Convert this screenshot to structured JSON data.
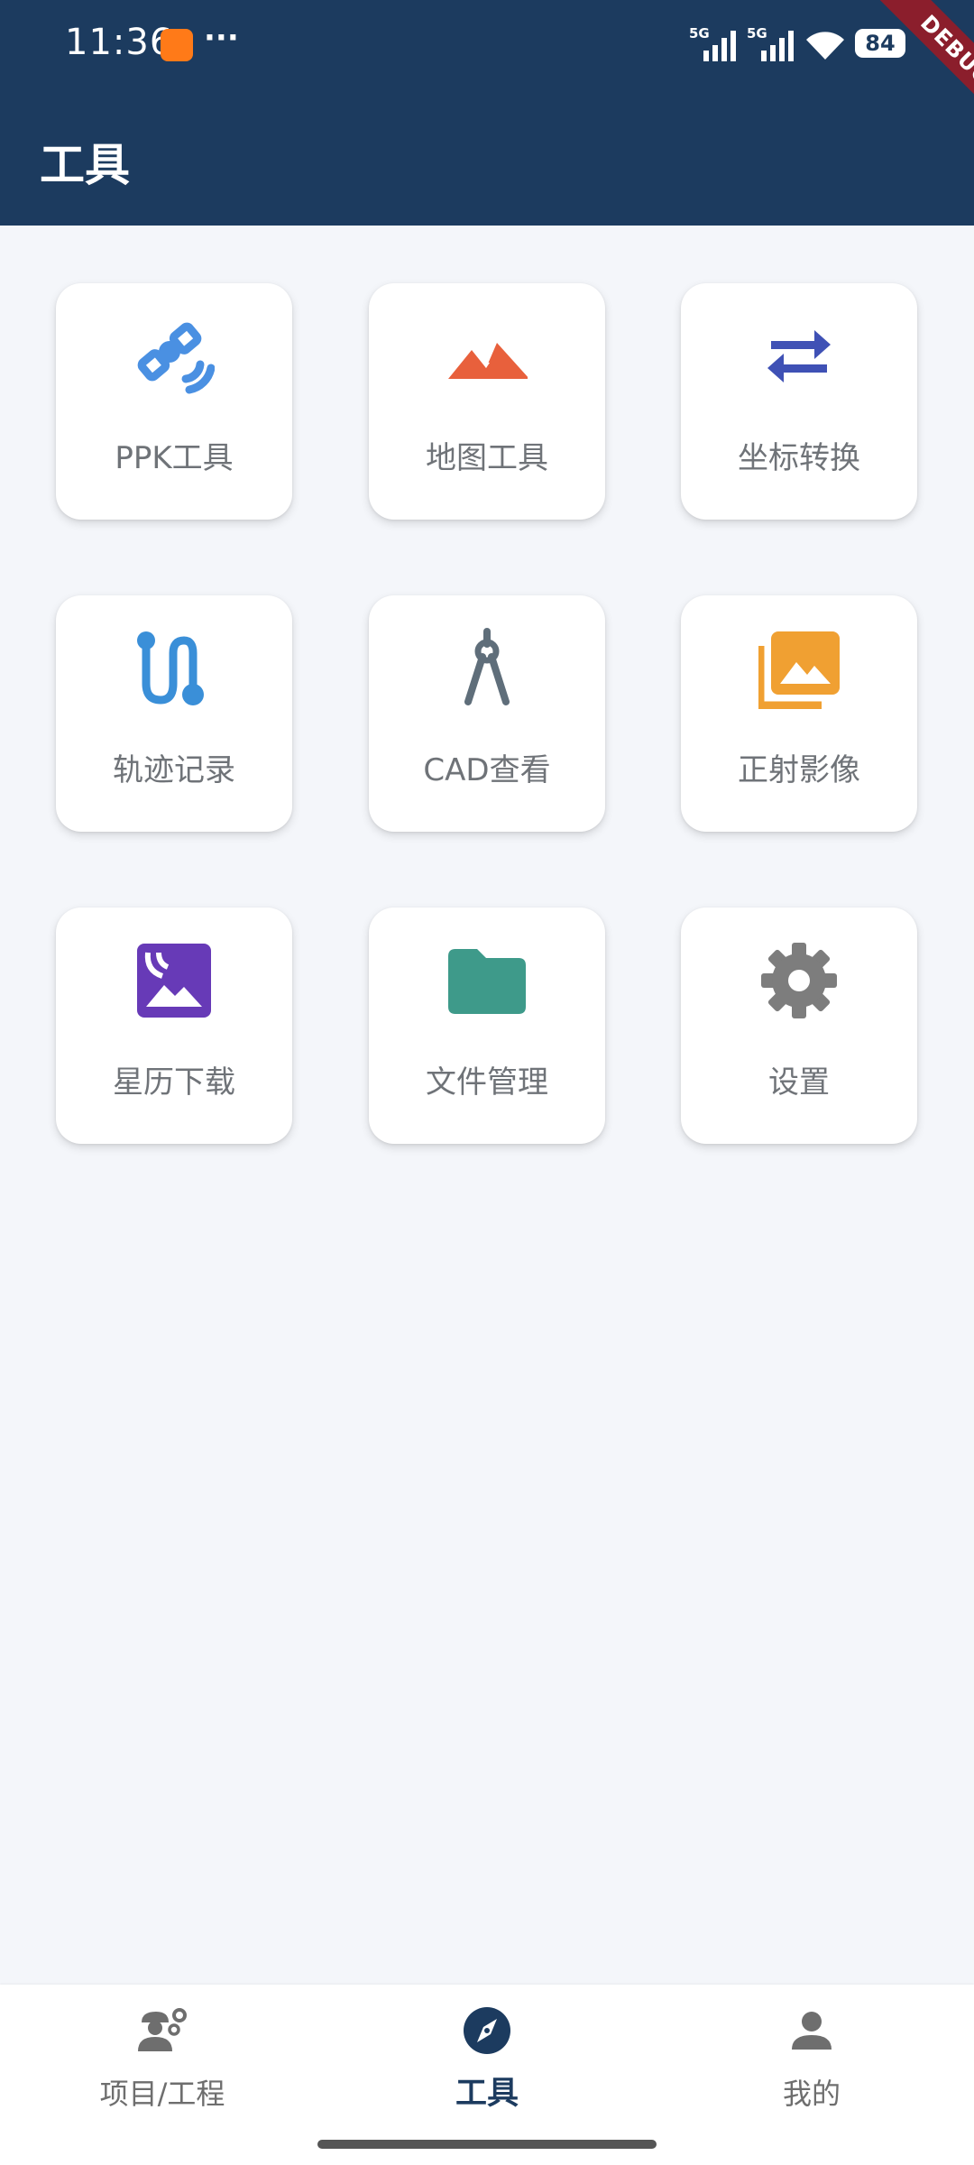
{
  "status_bar": {
    "time": "11:36",
    "more": "···",
    "signal_1_label": "5G",
    "signal_2_label": "5G",
    "battery": "84",
    "debug_banner": "DEBUG"
  },
  "header": {
    "title": "工具"
  },
  "tools": [
    {
      "label": "PPK工具",
      "icon": "satellite-icon",
      "color": "#4a90e2"
    },
    {
      "label": "地图工具",
      "icon": "mountain-icon",
      "color": "#e8603c"
    },
    {
      "label": "坐标转换",
      "icon": "swap-arrows-icon",
      "color": "#3f51b5"
    },
    {
      "label": "轨迹记录",
      "icon": "route-icon",
      "color": "#3a8fd8"
    },
    {
      "label": "CAD查看",
      "icon": "compass-drafting-icon",
      "color": "#5f6e7a"
    },
    {
      "label": "正射影像",
      "icon": "photo-library-icon",
      "color": "#f0a032"
    },
    {
      "label": "星历下载",
      "icon": "satellite-image-icon",
      "color": "#673ab7"
    },
    {
      "label": "文件管理",
      "icon": "folder-icon",
      "color": "#3e9a8a"
    },
    {
      "label": "设置",
      "icon": "gear-icon",
      "color": "#7d7d7d"
    }
  ],
  "bottom_nav": {
    "items": [
      {
        "label": "项目/工程",
        "icon": "engineer-gear-icon",
        "active": false
      },
      {
        "label": "工具",
        "icon": "compass-icon",
        "active": true
      },
      {
        "label": "我的",
        "icon": "person-icon",
        "active": false
      }
    ]
  },
  "colors": {
    "header_bg": "#1c3b5f",
    "page_bg": "#f4f6fa",
    "label": "#6f7378",
    "nav_active": "#1c3b5f",
    "nav_inactive": "#6e6e6e"
  }
}
